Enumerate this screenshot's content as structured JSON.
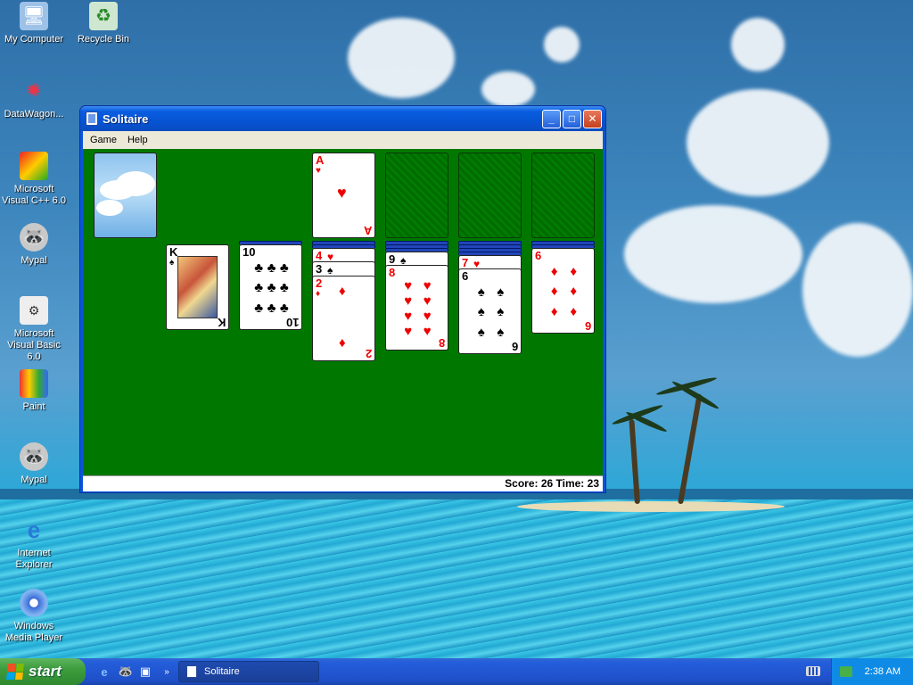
{
  "desktop": {
    "icons": [
      {
        "label": "My Computer",
        "icon": "computer-icon"
      },
      {
        "label": "Recycle Bin",
        "icon": "recycle-bin-icon"
      },
      {
        "label": "DataWagon...",
        "icon": "datawagon-icon"
      },
      {
        "label": "Microsoft Visual C++ 6.0",
        "icon": "visual-cpp-icon"
      },
      {
        "label": "Mypal",
        "icon": "mypal-icon"
      },
      {
        "label": "Microsoft Visual Basic 6.0",
        "icon": "visual-basic-icon"
      },
      {
        "label": "Paint",
        "icon": "paint-icon"
      },
      {
        "label": "Mypal",
        "icon": "mypal-icon"
      },
      {
        "label": "Internet Explorer",
        "icon": "internet-explorer-icon"
      },
      {
        "label": "Windows Media Player",
        "icon": "media-player-icon"
      }
    ]
  },
  "window": {
    "title": "Solitaire",
    "controls": {
      "minimize": "_",
      "maximize": "□",
      "close": "✕"
    },
    "menu": [
      "Game",
      "Help"
    ],
    "status": "Score: 26 Time: 23"
  },
  "cards": {
    "foundation_1": {
      "rank": "A",
      "suit": "♥",
      "color": "red"
    },
    "tableau_2": {
      "rank": "K",
      "suit": "♠",
      "color": "black"
    },
    "tableau_3": {
      "rank": "10",
      "suit": "♣",
      "color": "black"
    },
    "tableau_4": [
      {
        "rank": "4",
        "suit": "♥",
        "color": "red"
      },
      {
        "rank": "3",
        "suit": "♠",
        "color": "black"
      },
      {
        "rank": "2",
        "suit": "♦",
        "color": "red"
      }
    ],
    "tableau_5": [
      {
        "rank": "9",
        "suit": "♠",
        "color": "black"
      },
      {
        "rank": "8",
        "suit": "♥",
        "color": "red"
      }
    ],
    "tableau_6": [
      {
        "rank": "7",
        "suit": "♥",
        "color": "red"
      },
      {
        "rank": "6",
        "suit": "♠",
        "color": "black"
      }
    ],
    "tableau_7": {
      "rank": "6",
      "suit": "♦",
      "color": "red"
    }
  },
  "taskbar": {
    "start_label": "start",
    "active_task": "Solitaire",
    "clock": "2:38 AM"
  }
}
